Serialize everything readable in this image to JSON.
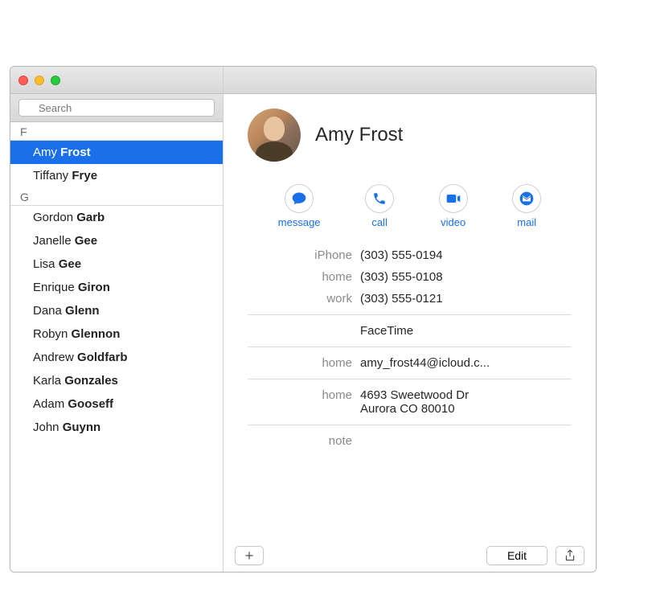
{
  "search": {
    "placeholder": "Search"
  },
  "sections": [
    {
      "letter": "F",
      "contacts": [
        {
          "first": "Amy",
          "last": "Frost",
          "selected": true
        },
        {
          "first": "Tiffany",
          "last": "Frye",
          "selected": false
        }
      ]
    },
    {
      "letter": "G",
      "contacts": [
        {
          "first": "Gordon",
          "last": "Garb",
          "selected": false
        },
        {
          "first": "Janelle",
          "last": "Gee",
          "selected": false
        },
        {
          "first": "Lisa",
          "last": "Gee",
          "selected": false
        },
        {
          "first": "Enrique",
          "last": "Giron",
          "selected": false
        },
        {
          "first": "Dana",
          "last": "Glenn",
          "selected": false
        },
        {
          "first": "Robyn",
          "last": "Glennon",
          "selected": false
        },
        {
          "first": "Andrew",
          "last": "Goldfarb",
          "selected": false
        },
        {
          "first": "Karla",
          "last": "Gonzales",
          "selected": false
        },
        {
          "first": "Adam",
          "last": "Gooseff",
          "selected": false
        },
        {
          "first": "John",
          "last": "Guynn",
          "selected": false
        }
      ]
    }
  ],
  "detail": {
    "name": "Amy Frost",
    "actions": {
      "message": "message",
      "call": "call",
      "video": "video",
      "mail": "mail"
    },
    "phones": [
      {
        "label": "iPhone",
        "value": "(303) 555-0194"
      },
      {
        "label": "home",
        "value": "(303) 555-0108"
      },
      {
        "label": "work",
        "value": "(303) 555-0121"
      }
    ],
    "facetime": {
      "label": "",
      "value": "FaceTime"
    },
    "email": {
      "label": "home",
      "value": "amy_frost44@icloud.c..."
    },
    "address": {
      "label": "home",
      "line1": "4693 Sweetwood Dr",
      "line2": "Aurora CO 80010"
    },
    "note_label": "note"
  },
  "footer": {
    "edit": "Edit"
  }
}
